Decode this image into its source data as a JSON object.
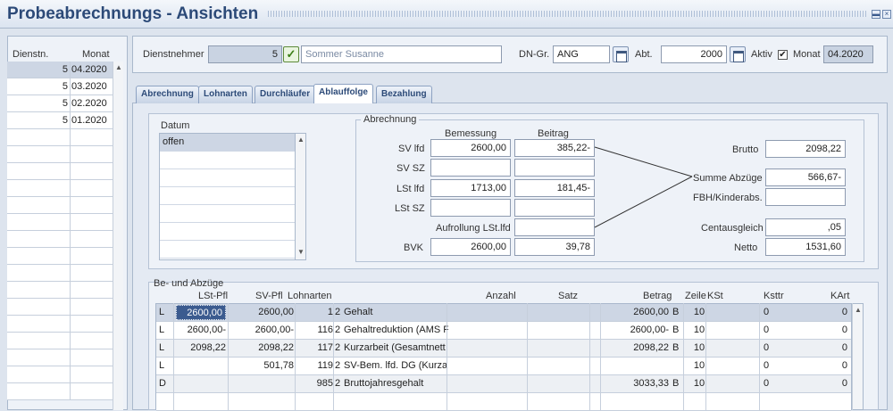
{
  "window": {
    "title": "Probeabrechnungs - Ansichten"
  },
  "left_list": {
    "headers": [
      "Dienstn.",
      "Monat"
    ],
    "rows": [
      {
        "nr": "5",
        "month": "04.2020"
      },
      {
        "nr": "5",
        "month": "03.2020"
      },
      {
        "nr": "5",
        "month": "02.2020"
      },
      {
        "nr": "5",
        "month": "01.2020"
      }
    ]
  },
  "header": {
    "employee_label": "Dienstnehmer",
    "employee_nr": "5",
    "employee_name": "Sommer Susanne",
    "dngr_label": "DN-Gr.",
    "dngr_value": "ANG",
    "abt_label": "Abt.",
    "abt_value": "2000",
    "aktiv_label": "Aktiv",
    "aktiv_checked": "✔",
    "monat_label": "Monat",
    "monat_value": "04.2020"
  },
  "tabs": [
    "Abrechnung",
    "Lohnarten",
    "Durchläufer",
    "Ablauffolge",
    "Bezahlung"
  ],
  "active_tab": "Ablauffolge",
  "datum": {
    "title": "Datum",
    "items": [
      "offen",
      "",
      "",
      "",
      "",
      "",
      ""
    ]
  },
  "abrechnung": {
    "title": "Abrechnung",
    "col_bemessung": "Bemessung",
    "col_beitrag": "Beitrag",
    "rows": [
      {
        "label": "SV lfd",
        "bemessung": "2600,00",
        "beitrag": "385,22-"
      },
      {
        "label": "SV SZ",
        "bemessung": "",
        "beitrag": ""
      },
      {
        "label": "LSt lfd",
        "bemessung": "1713,00",
        "beitrag": "181,45-"
      },
      {
        "label": "LSt SZ",
        "bemessung": "",
        "beitrag": ""
      }
    ],
    "aufrollung_label": "Aufrollung LSt.lfd",
    "aufrollung_value": "",
    "bvk_label": "BVK",
    "bvk_bemessung": "2600,00",
    "bvk_beitrag": "39,78",
    "brutto_label": "Brutto",
    "brutto_value": "2098,22",
    "abzuege_label": "Summe Abzüge",
    "abzuege_value": "566,67-",
    "fbh_label": "FBH/Kinderabs.",
    "fbh_value": "",
    "cent_label": "Centausgleich",
    "cent_value": ",05",
    "netto_label": "Netto",
    "netto_value": "1531,60"
  },
  "be_abzuege": {
    "title": "Be- und Abzüge",
    "headers": {
      "lstpfl": "LSt-Pfl",
      "svpfl": "SV-Pfl",
      "lohnarten": "Lohnarten",
      "anzahl": "Anzahl",
      "satz": "Satz",
      "betrag": "Betrag",
      "zeile": "Zeile",
      "kst": "KSt",
      "ksttr": "Ksttr",
      "kart": "KArt"
    },
    "rows": [
      {
        "typ": "L",
        "lstpfl": "2600,00",
        "svpfl": "2600,00",
        "nr": "1",
        "code": "2",
        "name": "Gehalt",
        "anzahl": "",
        "satz": "",
        "betrag": "2600,00",
        "b": "B",
        "zeile": "1",
        "kst": "0",
        "ksttr": "0",
        "kart": "0"
      },
      {
        "typ": "L",
        "lstpfl": "2600,00-",
        "svpfl": "2600,00-",
        "nr": "116",
        "code": "2",
        "name": "Gehaltreduktion (AMS F",
        "anzahl": "",
        "satz": "",
        "betrag": "2600,00-",
        "b": "B",
        "zeile": "1",
        "kst": "0",
        "ksttr": "0",
        "kart": "0"
      },
      {
        "typ": "L",
        "lstpfl": "2098,22",
        "svpfl": "2098,22",
        "nr": "117",
        "code": "2",
        "name": "Kurzarbeit (Gesamtnett",
        "anzahl": "",
        "satz": "",
        "betrag": "2098,22",
        "b": "B",
        "zeile": "1",
        "kst": "0",
        "ksttr": "0",
        "kart": "0"
      },
      {
        "typ": "L",
        "lstpfl": "",
        "svpfl": "501,78",
        "nr": "119",
        "code": "2",
        "name": "SV-Bem. lfd. DG (Kurza",
        "anzahl": "",
        "satz": "",
        "betrag": "",
        "b": "",
        "zeile": "1",
        "kst": "0",
        "ksttr": "0",
        "kart": "0"
      },
      {
        "typ": "D",
        "lstpfl": "",
        "svpfl": "",
        "nr": "985",
        "code": "2",
        "name": "Bruttojahresgehalt",
        "anzahl": "",
        "satz": "",
        "betrag": "3033,33",
        "b": "B",
        "zeile": "1",
        "kst": "0",
        "ksttr": "0",
        "kart": "0"
      }
    ]
  },
  "colors": {
    "title": "#2c4a78",
    "selected": "#cdd6e4",
    "edit": "#3b5b8f"
  }
}
